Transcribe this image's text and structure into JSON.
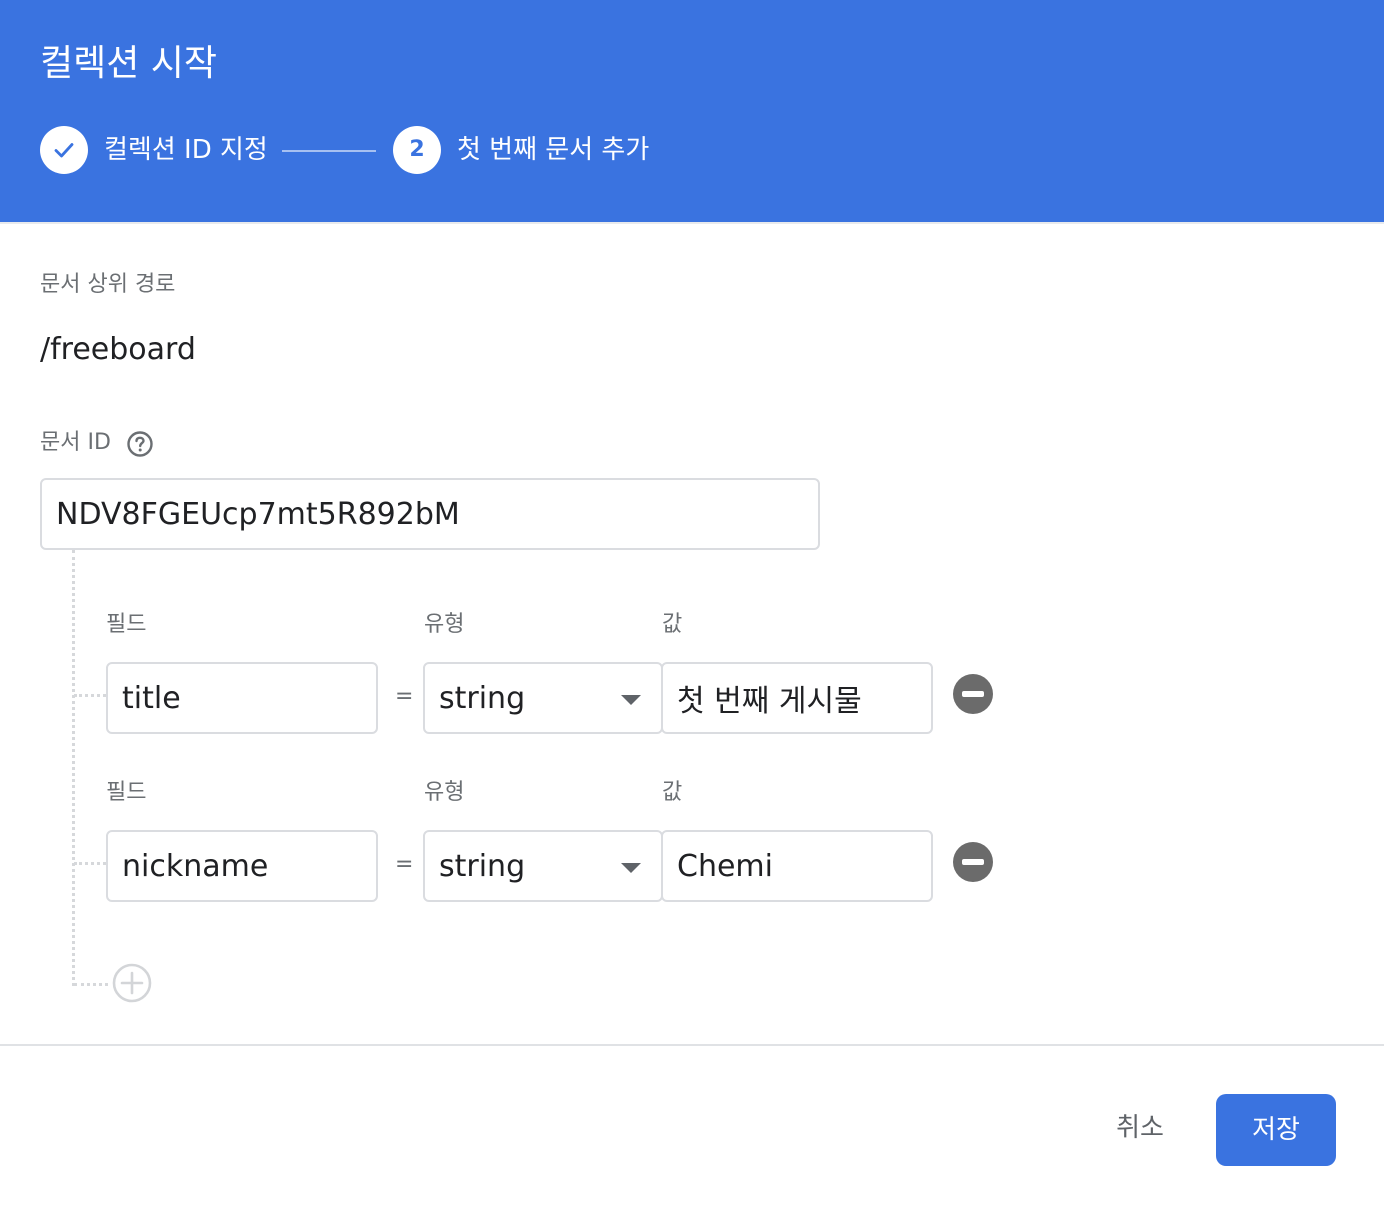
{
  "dialog": {
    "title": "컬렉션 시작",
    "steps": [
      {
        "label": "컬렉션 ID 지정",
        "state": "complete",
        "icon": "check-icon"
      },
      {
        "label": "첫 번째 문서 추가",
        "number": "2",
        "state": "active"
      }
    ]
  },
  "parent_path": {
    "label": "문서 상위 경로",
    "value": "/freeboard"
  },
  "document_id": {
    "label": "문서 ID",
    "value": "NDV8FGEUcp7mt5R892bM",
    "help_icon": "help-circle-icon"
  },
  "fields": [
    {
      "field_label": "필드",
      "type_label": "유형",
      "value_label": "값",
      "name": "title",
      "equals": "=",
      "type": "string",
      "value": "첫 번째 게시물"
    },
    {
      "field_label": "필드",
      "type_label": "유형",
      "value_label": "값",
      "name": "nickname",
      "equals": "=",
      "type": "string",
      "value": "Chemi"
    }
  ],
  "footer": {
    "cancel_label": "취소",
    "save_label": "저장"
  },
  "colors": {
    "header": "#3a73e0",
    "primary": "#3a73e0",
    "remove_icon": "#6b6b6b"
  }
}
